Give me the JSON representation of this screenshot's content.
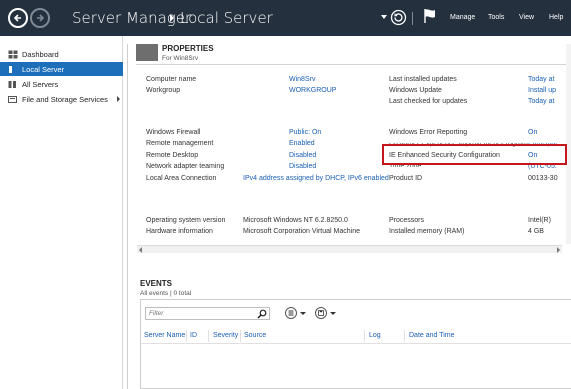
{
  "titlebar": {
    "app": "Server Manager",
    "page": "Local Server",
    "menus": [
      "Manage",
      "Tools",
      "View",
      "Help"
    ]
  },
  "nav": {
    "items": [
      {
        "label": "Dashboard",
        "icon": "dashboard-icon",
        "active": false
      },
      {
        "label": "Local Server",
        "icon": "server-icon",
        "active": true
      },
      {
        "label": "All Servers",
        "icon": "servers-icon",
        "active": false
      },
      {
        "label": "File and Storage Services",
        "icon": "storage-icon",
        "active": false
      }
    ]
  },
  "properties": {
    "title": "PROPERTIES",
    "subtitle": "For Win8Srv",
    "left": [
      {
        "label": "Computer name",
        "value": "Win8Srv"
      },
      {
        "label": "Workgroup",
        "value": "WORKGROUP"
      },
      {
        "label": "Windows Firewall",
        "value": "Public: On"
      },
      {
        "label": "Remote management",
        "value": "Enabled"
      },
      {
        "label": "Remote Desktop",
        "value": "Disabled"
      },
      {
        "label": "Network adapter teaming",
        "value": "Disabled"
      },
      {
        "label": "Local Area Connection",
        "value": "IPv4 address assigned by DHCP, IPv6 enabled"
      },
      {
        "label": "Operating system version",
        "value": "Microsoft Windows NT 6.2.8250.0"
      },
      {
        "label": "Hardware information",
        "value": "Microsoft Corporation Virtual Machine"
      }
    ],
    "right": [
      {
        "label": "Last installed updates",
        "value": "Today at"
      },
      {
        "label": "Windows Update",
        "value": "Install up"
      },
      {
        "label": "Last checked for updates",
        "value": "Today at"
      },
      {
        "label": "Windows Error Reporting",
        "value": "On"
      },
      {
        "label": "Customer Experience Improvement Program",
        "value": "Participat"
      },
      {
        "label": "IE Enhanced Security Configuration",
        "value": "On"
      },
      {
        "label": "Time zone",
        "value": "(UTC-05:"
      },
      {
        "label": "Product ID",
        "value": "00133-30"
      },
      {
        "label": "Processors",
        "value": "Intel(R)"
      },
      {
        "label": "Installed memory (RAM)",
        "value": "4 GB"
      }
    ]
  },
  "events": {
    "title": "EVENTS",
    "subtitle": "All events | 0 total",
    "filter_placeholder": "Filter",
    "columns": [
      "Server Name",
      "ID",
      "Severity",
      "Source",
      "Log",
      "Date and Time"
    ]
  },
  "colors": {
    "titlebar": "#24303e",
    "accent": "#1c6fb8",
    "link": "#1a5fb4",
    "highlight": "#c4161c"
  }
}
